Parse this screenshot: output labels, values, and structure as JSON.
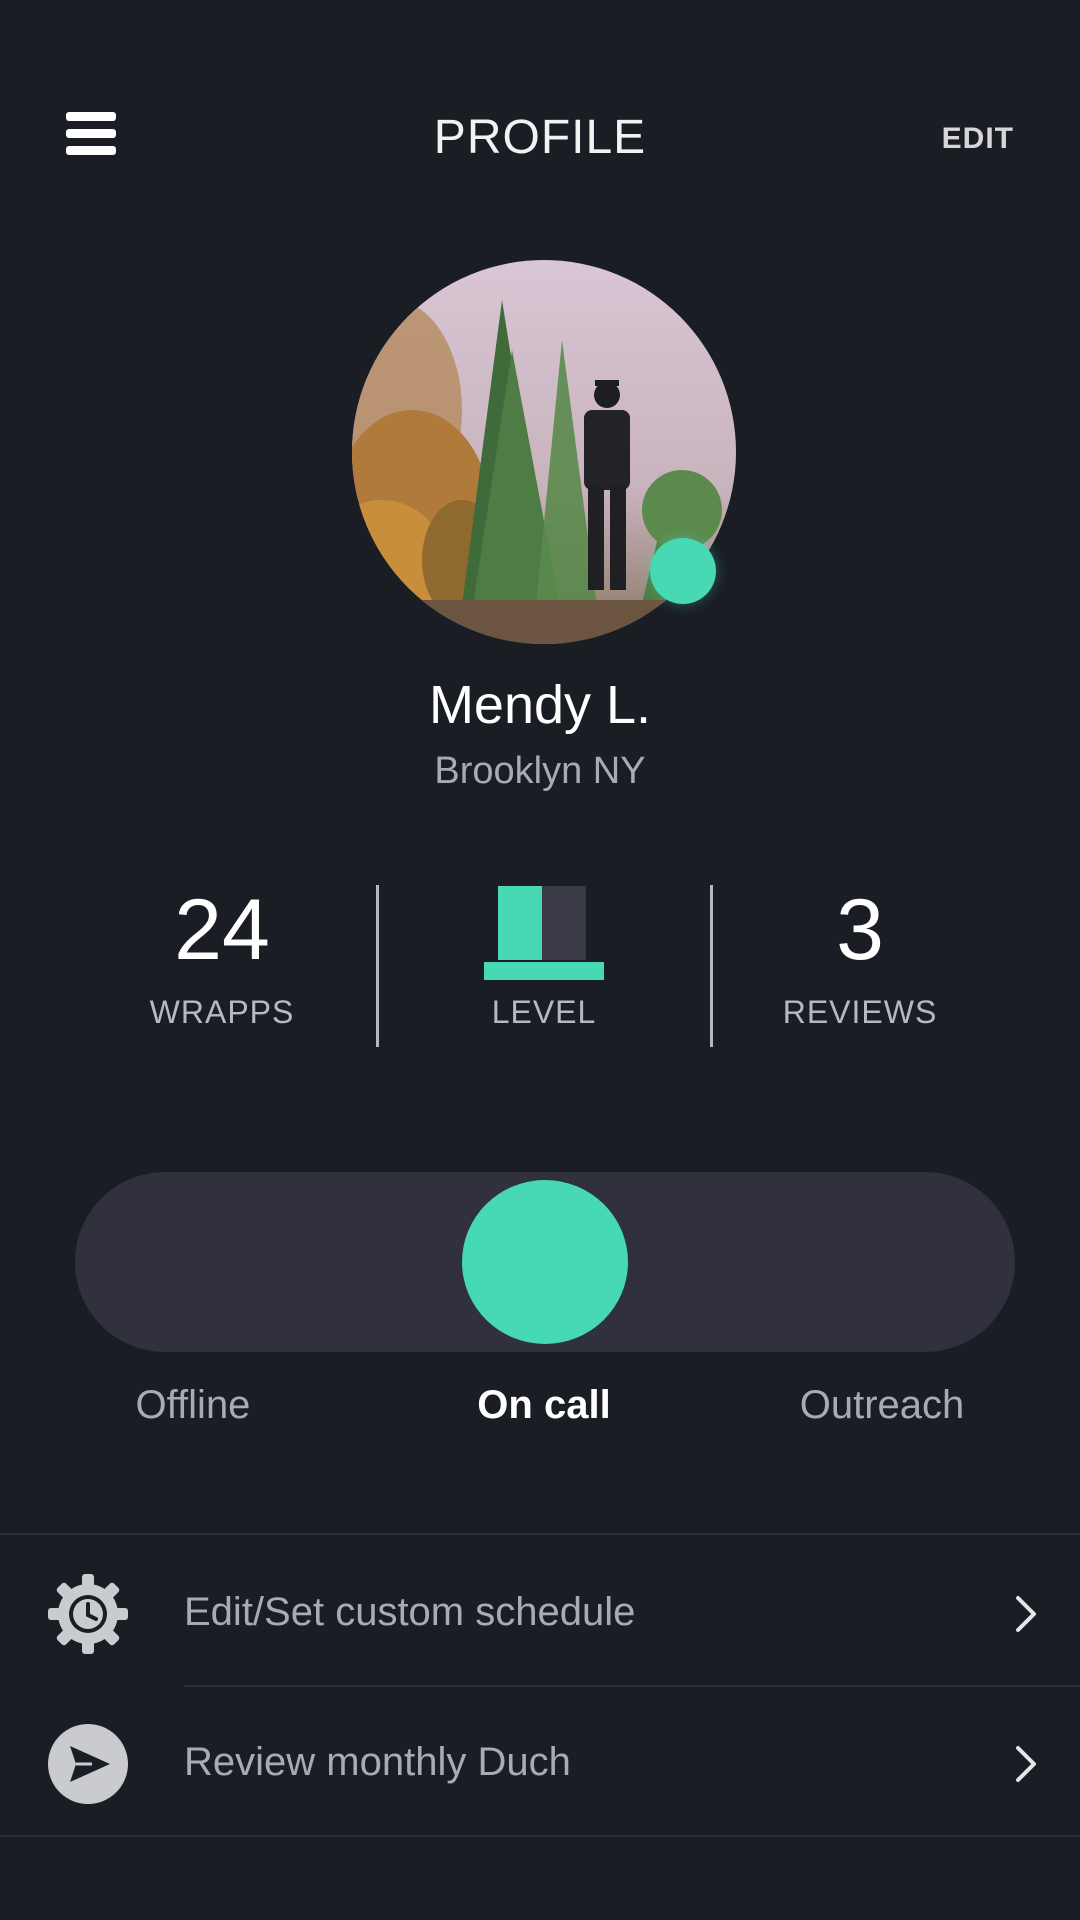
{
  "header": {
    "title": "PROFILE",
    "edit_label": "EDIT"
  },
  "profile": {
    "name": "Mendy L.",
    "location": "Brooklyn NY",
    "online": true
  },
  "stats": {
    "wrapps": {
      "value": "24",
      "label": "WRAPPS"
    },
    "level": {
      "label": "LEVEL",
      "filled": 2,
      "total": 4
    },
    "reviews": {
      "value": "3",
      "label": "REVIEWS"
    }
  },
  "status": {
    "options": [
      "Offline",
      "On call",
      "Outreach"
    ],
    "selected": "On call"
  },
  "menu": {
    "items": [
      {
        "label": "Edit/Set custom schedule",
        "icon": "gear-clock-icon"
      },
      {
        "label": "Review monthly Duch",
        "icon": "send-icon"
      }
    ]
  },
  "colors": {
    "background": "#1a1d24",
    "accent": "#46d9b4",
    "track": "#31313e",
    "muted_text": "#a9abb2"
  }
}
